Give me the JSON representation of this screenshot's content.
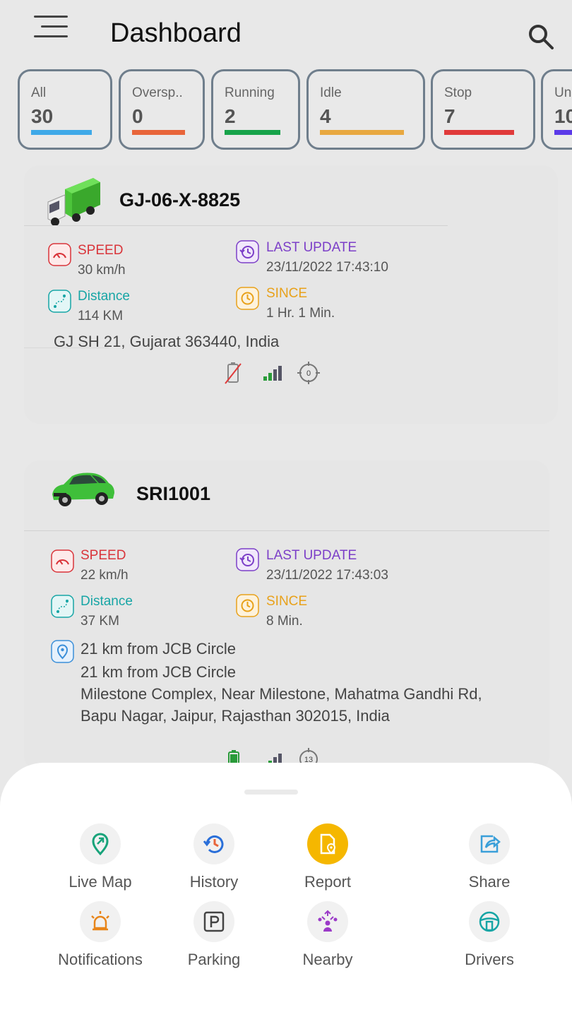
{
  "header": {
    "title": "Dashboard"
  },
  "filters": [
    {
      "label": "All",
      "count": "30",
      "color": "#3fa9e8"
    },
    {
      "label": "Oversp..",
      "count": "0",
      "color": "#e8653a"
    },
    {
      "label": "Running",
      "count": "2",
      "color": "#17a34a"
    },
    {
      "label": "Idle",
      "count": "4",
      "color": "#e8a840"
    },
    {
      "label": "Stop",
      "count": "7",
      "color": "#e03a3a"
    },
    {
      "label": "Un",
      "count": "10",
      "color": "#5b3ae8"
    }
  ],
  "vehicles": [
    {
      "name": "GJ-06-X-8825",
      "type": "truck",
      "speed_label": "SPEED",
      "speed_value": "30 km/h",
      "last_update_label": "LAST UPDATE",
      "last_update_value": "23/11/2022 17:43:10",
      "distance_label": "Distance",
      "distance_value": "114 KM",
      "since_label": "SINCE",
      "since_value": "1 Hr. 1 Min.",
      "address": "GJ SH 21, Gujarat 363440, India",
      "satellites": "0"
    },
    {
      "name": "SRI1001",
      "type": "car",
      "speed_label": "SPEED",
      "speed_value": "22 km/h",
      "last_update_label": "LAST UPDATE",
      "last_update_value": "23/11/2022 17:43:03",
      "distance_label": "Distance",
      "distance_value": "37 KM",
      "since_label": "SINCE",
      "since_value": "8 Min.",
      "address_line1": "21 km from JCB Circle",
      "address_line2": "21 km from JCB Circle",
      "address_line3": "Milestone Complex, Near Milestone, Mahatma Gandhi Rd,",
      "address_line4": "Bapu Nagar, Jaipur, Rajasthan 302015, India",
      "satellites": "13"
    }
  ],
  "colors": {
    "speed": "#d9343a",
    "last_update": "#7c3fc8",
    "distance": "#17a5a5",
    "since": "#e8a11a",
    "report_accent": "#f5b700"
  },
  "actions": [
    {
      "label": "Live Map",
      "icon": "live-map-pin-icon"
    },
    {
      "label": "History",
      "icon": "history-clock-icon"
    },
    {
      "label": "Report",
      "icon": "report-document-icon"
    },
    {
      "label": "Share",
      "icon": "share-arrow-icon"
    },
    {
      "label": "Notifications",
      "icon": "alarm-bell-icon"
    },
    {
      "label": "Parking",
      "icon": "parking-icon"
    },
    {
      "label": "Nearby",
      "icon": "nearby-people-icon"
    },
    {
      "label": "Drivers",
      "icon": "steering-wheel-icon"
    }
  ]
}
